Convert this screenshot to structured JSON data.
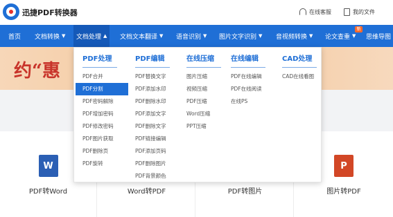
{
  "header": {
    "brand": "迅捷PDF转换器",
    "tools": [
      "在线客服",
      "我的文件"
    ]
  },
  "nav": {
    "items": [
      {
        "label": "首页",
        "caret": ""
      },
      {
        "label": "文档转换",
        "caret": "▼"
      },
      {
        "label": "文档处理",
        "caret": "▲"
      },
      {
        "label": "文档文本翻译",
        "caret": "▼"
      },
      {
        "label": "语音识别",
        "caret": "▼"
      },
      {
        "label": "图片文字识别",
        "caret": "▼"
      },
      {
        "label": "音视频转换",
        "caret": "▼"
      },
      {
        "label": "论文查重",
        "caret": "▼"
      },
      {
        "label": "思维导图",
        "caret": ""
      }
    ],
    "badge": "新"
  },
  "banner": {
    "text": "约“惠"
  },
  "dropdown": {
    "columns": [
      {
        "title": "PDF处理",
        "items": [
          "PDF合并",
          "PDF分割",
          "PDF密码解除",
          "PDF增加密码",
          "PDF修改密码",
          "PDF图片获取",
          "PDF删除页",
          "PDF旋转"
        ]
      },
      {
        "title": "PDF编辑",
        "items": [
          "PDF替换文字",
          "PDF添加水印",
          "PDF删除水印",
          "PDF添加文字",
          "PDF删除文字",
          "PDF链接编辑",
          "PDF添加页码",
          "PDF删除图片",
          "PDF背景颜色"
        ]
      },
      {
        "title": "在线压缩",
        "items": [
          "图片压缩",
          "视频压缩",
          "PDF压缩",
          "Word压缩",
          "PPT压缩"
        ]
      },
      {
        "title": "在线编辑",
        "items": [
          "PDF在线编辑",
          "PDF在线阅读",
          "在线PS"
        ]
      },
      {
        "title": "CAD处理",
        "items": [
          "CAD在线看图"
        ]
      }
    ]
  },
  "cards": [
    {
      "label": "PDF转Word",
      "icon": "W"
    },
    {
      "label": "Word转PDF",
      "icon": ""
    },
    {
      "label": "PDF转图片",
      "icon": ""
    },
    {
      "label": "图片转PDF",
      "icon": "P"
    }
  ],
  "colors": {
    "nav_blue": "#1f6fd6",
    "word_blue": "#2b5fb4",
    "ppt_red": "#d24726"
  }
}
